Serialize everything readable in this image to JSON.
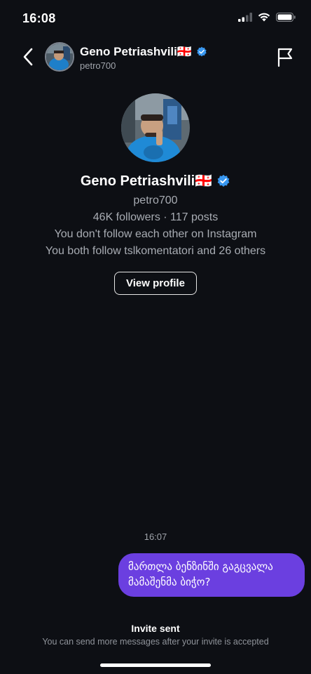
{
  "status_bar": {
    "time": "16:08"
  },
  "header": {
    "name": "Geno Petriashvili🇬🇪",
    "username": "petro700"
  },
  "profile": {
    "name": "Geno Petriashvili🇬🇪",
    "username": "petro700",
    "stats": "46K followers · 117 posts",
    "follow_status": "You don't follow each other on Instagram",
    "mutual": "You both follow tslkomentatori and 26 others",
    "view_profile_label": "View profile"
  },
  "conversation": {
    "timestamp": "16:07",
    "message": "მართლა ბენზინში გაგცვალა მამაშენმა ბიჭო?"
  },
  "footer": {
    "title": "Invite sent",
    "subtitle": "You can send more messages after your invite is accepted"
  },
  "colors": {
    "background": "#0d0f14",
    "bubble": "#6b3fe0",
    "verified": "#3897f0"
  }
}
